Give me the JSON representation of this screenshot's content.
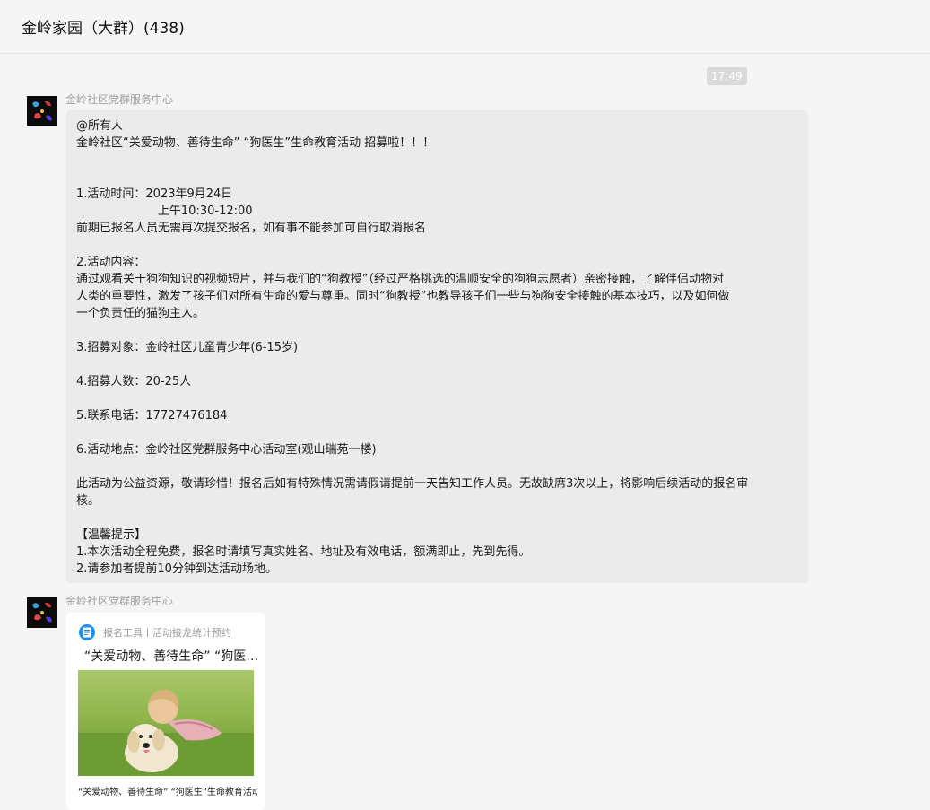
{
  "header": {
    "title": "金岭家园（大群）(438)"
  },
  "timestamp": "17:49",
  "messages": [
    {
      "sender": "金岭社区党群服务中心",
      "lines": [
        "@所有人",
        "金岭社区“关爱动物、善待生命” “狗医生”生命教育活动 招募啦！！！",
        "",
        "",
        "1.活动时间：2023年9月24日",
        "                      上午10:30-12:00",
        "前期已报名人员无需再次提交报名，如有事不能参加可自行取消报名",
        "",
        "2.活动内容：",
        "通过观看关于狗狗知识的视频短片，并与我们的“狗教授”（经过严格挑选的温顺安全的狗狗志愿者）亲密接触，了解伴侣动物对",
        "人类的重要性，激发了孩子们对所有生命的爱与尊重。同时“狗教授”也教导孩子们一些与狗狗安全接触的基本技巧，以及如何做",
        "一个负责任的猫狗主人。",
        "",
        "3.招募对象：金岭社区儿童青少年(6-15岁)",
        "",
        "4.招募人数：20-25人",
        "",
        "5.联系电话：17727476184",
        "",
        "6.活动地点：金岭社区党群服务中心活动室(观山瑞苑一楼)",
        "",
        "此活动为公益资源，敬请珍惜！报名后如有特殊情况需请假请提前一天告知工作人员。无故缺席3次以上，将影响后续活动的报名审",
        "核。",
        "",
        "【温馨提示】",
        "1.本次活动全程免费，报名时请填写真实姓名、地址及有效电话，额满即止，先到先得。",
        "2.请参加者提前10分钟到达活动场地。"
      ]
    },
    {
      "sender": "金岭社区党群服务中心",
      "card": {
        "app_name": "报名工具丨活动接龙统计预约",
        "title": "“关爱动物、善待生命” “狗医生”生命教育活动 招募啦",
        "caption": "“关爱动物、善待生命” “狗医生”生命教育活动"
      }
    }
  ],
  "icons": {
    "avatar": "party-emblem-avatar",
    "app": "document-icon"
  }
}
